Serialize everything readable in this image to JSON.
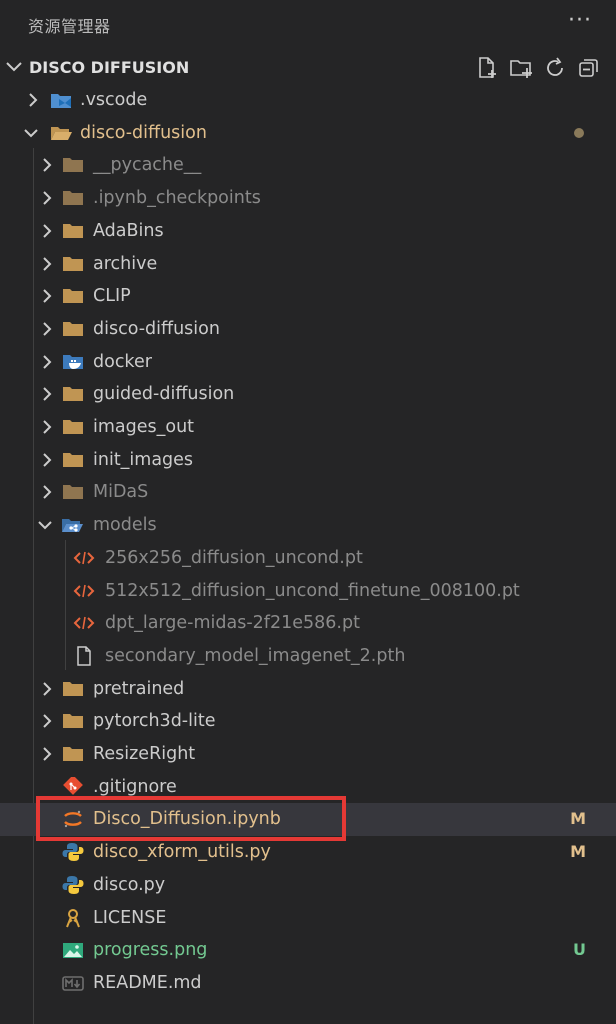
{
  "panel": {
    "title": "资源管理器",
    "more_label": "···"
  },
  "section": {
    "title": "DISCO DIFFUSION"
  },
  "toolbar": [
    "new-file",
    "new-folder",
    "refresh",
    "collapse-all"
  ],
  "colors": {
    "modified": "#e2c08d",
    "untracked": "#73c991",
    "selection_box": "#e53935"
  },
  "tree": [
    {
      "label": ".vscode",
      "kind": "folder-collapsed",
      "icon": "vscode-folder-icon"
    },
    {
      "label": "disco-diffusion",
      "kind": "folder-open",
      "icon": "folder-open-icon",
      "status": "dot"
    },
    {
      "label": "__pycache__",
      "kind": "folder-collapsed",
      "icon": "folder-icon",
      "dim": true
    },
    {
      "label": ".ipynb_checkpoints",
      "kind": "folder-collapsed",
      "icon": "folder-icon",
      "dim": true
    },
    {
      "label": "AdaBins",
      "kind": "folder-collapsed",
      "icon": "folder-icon"
    },
    {
      "label": "archive",
      "kind": "folder-collapsed",
      "icon": "folder-icon"
    },
    {
      "label": "CLIP",
      "kind": "folder-collapsed",
      "icon": "folder-icon"
    },
    {
      "label": "disco-diffusion",
      "kind": "folder-collapsed",
      "icon": "folder-icon"
    },
    {
      "label": "docker",
      "kind": "folder-collapsed",
      "icon": "docker-folder-icon"
    },
    {
      "label": "guided-diffusion",
      "kind": "folder-collapsed",
      "icon": "folder-icon"
    },
    {
      "label": "images_out",
      "kind": "folder-collapsed",
      "icon": "folder-icon"
    },
    {
      "label": "init_images",
      "kind": "folder-collapsed",
      "icon": "folder-icon"
    },
    {
      "label": "MiDaS",
      "kind": "folder-collapsed",
      "icon": "folder-icon",
      "dim": true
    },
    {
      "label": "models",
      "kind": "folder-open",
      "icon": "models-folder-icon",
      "dim": true
    },
    {
      "label": "256x256_diffusion_uncond.pt",
      "kind": "file",
      "icon": "code-file-icon",
      "dim": true
    },
    {
      "label": "512x512_diffusion_uncond_finetune_008100.pt",
      "kind": "file",
      "icon": "code-file-icon",
      "dim": true
    },
    {
      "label": "dpt_large-midas-2f21e586.pt",
      "kind": "file",
      "icon": "code-file-icon",
      "dim": true
    },
    {
      "label": "secondary_model_imagenet_2.pth",
      "kind": "file",
      "icon": "blank-file-icon",
      "dim": true
    },
    {
      "label": "pretrained",
      "kind": "folder-collapsed",
      "icon": "folder-icon"
    },
    {
      "label": "pytorch3d-lite",
      "kind": "folder-collapsed",
      "icon": "folder-icon"
    },
    {
      "label": "ResizeRight",
      "kind": "folder-collapsed",
      "icon": "folder-icon"
    },
    {
      "label": ".gitignore",
      "kind": "file",
      "icon": "git-icon"
    },
    {
      "label": "Disco_Diffusion.ipynb",
      "kind": "file",
      "icon": "jupyter-icon",
      "status": "M",
      "selected": true
    },
    {
      "label": "disco_xform_utils.py",
      "kind": "file",
      "icon": "python-icon",
      "status": "M"
    },
    {
      "label": "disco.py",
      "kind": "file",
      "icon": "python-icon"
    },
    {
      "label": "LICENSE",
      "kind": "file",
      "icon": "license-icon"
    },
    {
      "label": "progress.png",
      "kind": "file",
      "icon": "image-icon",
      "status": "U"
    },
    {
      "label": "README.md",
      "kind": "file",
      "icon": "markdown-icon"
    }
  ]
}
